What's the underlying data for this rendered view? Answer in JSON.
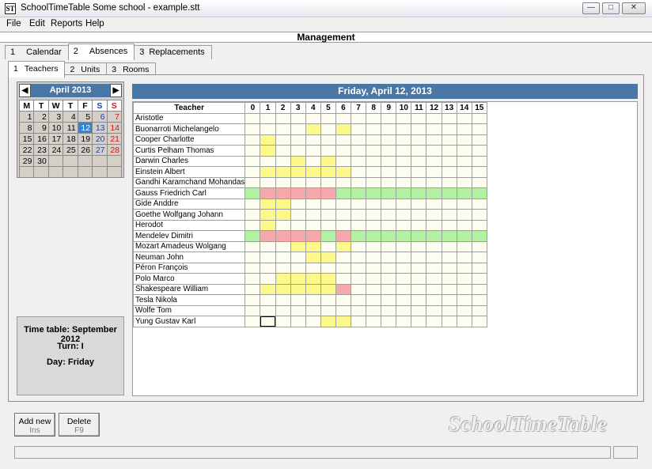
{
  "window": {
    "title": "SchoolTimeTable Some school - example.stt",
    "icon_text": "ST",
    "minimize": "—",
    "maximize": "□",
    "close": "✕"
  },
  "menu": [
    "File",
    "Edit",
    "Reports",
    "Help"
  ],
  "header": {
    "title": "Management"
  },
  "tabs": [
    {
      "num": "1",
      "label": "Calendar"
    },
    {
      "num": "2",
      "label": "Absences"
    },
    {
      "num": "3",
      "label": "Replacements"
    }
  ],
  "subtabs": [
    {
      "num": "1",
      "label": "Teachers"
    },
    {
      "num": "2",
      "label": "Units"
    },
    {
      "num": "3",
      "label": "Rooms"
    }
  ],
  "calendar": {
    "month": "April 2013",
    "prev": "◀",
    "next": "▶",
    "dow": [
      "M",
      "T",
      "W",
      "T",
      "F",
      "S",
      "S"
    ],
    "weeks": [
      [
        "1",
        "2",
        "3",
        "4",
        "5",
        "6",
        "7"
      ],
      [
        "8",
        "9",
        "10",
        "11",
        "12",
        "13",
        "14"
      ],
      [
        "15",
        "16",
        "17",
        "18",
        "19",
        "20",
        "21"
      ],
      [
        "22",
        "23",
        "24",
        "25",
        "26",
        "27",
        "28"
      ],
      [
        "29",
        "30",
        "",
        "",
        "",
        "",
        ""
      ],
      [
        "",
        "",
        "",
        "",
        "",
        "",
        ""
      ]
    ],
    "selected": "12"
  },
  "info": {
    "timetable": "Time table: September 2012",
    "turn": "Turn: I",
    "day": "Day: Friday"
  },
  "schedule": {
    "date": "Friday, April 12, 2013",
    "teacher_header": "Teacher",
    "periods": [
      "0",
      "1",
      "2",
      "3",
      "4",
      "5",
      "6",
      "7",
      "8",
      "9",
      "10",
      "11",
      "12",
      "13",
      "14",
      "15"
    ],
    "legend_colors": {
      "y": "#fcf88a",
      "r": "#f6a9ad",
      "g": "#b3f2a5"
    },
    "rows": [
      {
        "name": "Aristotle",
        "cells": "................"
      },
      {
        "name": "Buonarroti Michelangelo",
        "cells": "....y.y........."
      },
      {
        "name": "Cooper Charlotte",
        "cells": ".y.............."
      },
      {
        "name": "Curtis Pelham Thomas",
        "cells": ".y.............."
      },
      {
        "name": "Darwin Charles",
        "cells": "...y.y.........."
      },
      {
        "name": "Einstein Albert",
        "cells": ".yyyyyy........."
      },
      {
        "name": "Gandhi Karamchand Mohandas",
        "cells": "................"
      },
      {
        "name": "Gauss Friedrich Carl",
        "cells": "grrrrrgggggggggg"
      },
      {
        "name": "Gide Anddre",
        "cells": ".yy............."
      },
      {
        "name": "Goethe Wolfgang Johann",
        "cells": ".yy............."
      },
      {
        "name": "Herodot",
        "cells": ".y.............."
      },
      {
        "name": "Mendelev Dimitri",
        "cells": "grrrrgrggggggggg"
      },
      {
        "name": "Mozart Amadeus Wolgang",
        "cells": "...yy.y........."
      },
      {
        "name": "Neuman John",
        "cells": "....yy.........."
      },
      {
        "name": "Péron François",
        "cells": "................"
      },
      {
        "name": "Polo Marco",
        "cells": "..yyyy.........."
      },
      {
        "name": "Shakespeare William",
        "cells": ".yyyyyr........."
      },
      {
        "name": "Tesla Nikola",
        "cells": "................"
      },
      {
        "name": "Wolfe Tom",
        "cells": "................"
      },
      {
        "name": "Yung Gustav Karl",
        "cells": ".o...yy........."
      }
    ]
  },
  "buttons": {
    "add": {
      "label": "Add new",
      "hint": "Ins"
    },
    "delete": {
      "label": "Delete",
      "hint": "F9"
    }
  },
  "brand": "SchoolTimeTable"
}
